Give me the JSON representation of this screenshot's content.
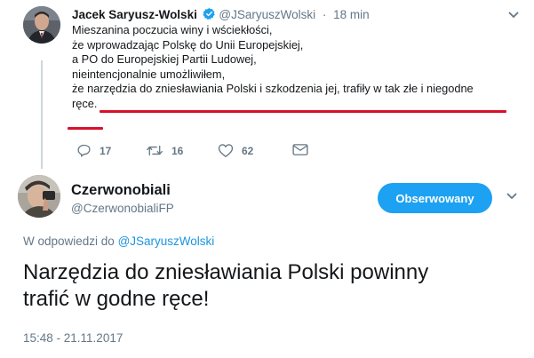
{
  "colors": {
    "accent": "#1da1f2",
    "link": "#1b95e0",
    "muted": "#657786",
    "text": "#14171a",
    "underline_red": "#d8102a",
    "verified": "#1da1f2"
  },
  "parent_tweet": {
    "name": "Jacek Saryusz-Wolski",
    "handle": "@JSaryuszWolski",
    "separator": "·",
    "time": "18 min",
    "icons": [
      "verified-badge-icon",
      "chevron-down-icon"
    ],
    "text_lines": [
      "Mieszanina poczucia winy i wściekłości,",
      "że wprowadzając Polskę do Unii Europejskiej,",
      "a PO do Europejskiej Partii Ludowej,",
      "nieintencjonalnie umożliwiłem,",
      "że narzędzia do zniesławiania Polski i szkodzenia jej, trafiły w tak złe i niegodne",
      "ręce."
    ],
    "actions": {
      "reply": {
        "icon": "reply-icon",
        "count": "17"
      },
      "retweet": {
        "icon": "retweet-icon",
        "count": "16"
      },
      "like": {
        "icon": "heart-icon",
        "count": "62"
      },
      "dm": {
        "icon": "envelope-icon"
      }
    }
  },
  "main_tweet": {
    "name": "Czerwonobiali",
    "handle": "@CzerwonobialiFP",
    "follow_label": "Obserwowany",
    "reply_prefix": "W odpowiedzi do",
    "reply_to": "@JSaryuszWolski",
    "text_lines": [
      "Narzędzia do zniesławiania Polski powinny",
      "trafić w godne ręce!"
    ],
    "timestamp": "15:48 - 21.11.2017",
    "icons": [
      "chevron-down-icon"
    ]
  }
}
